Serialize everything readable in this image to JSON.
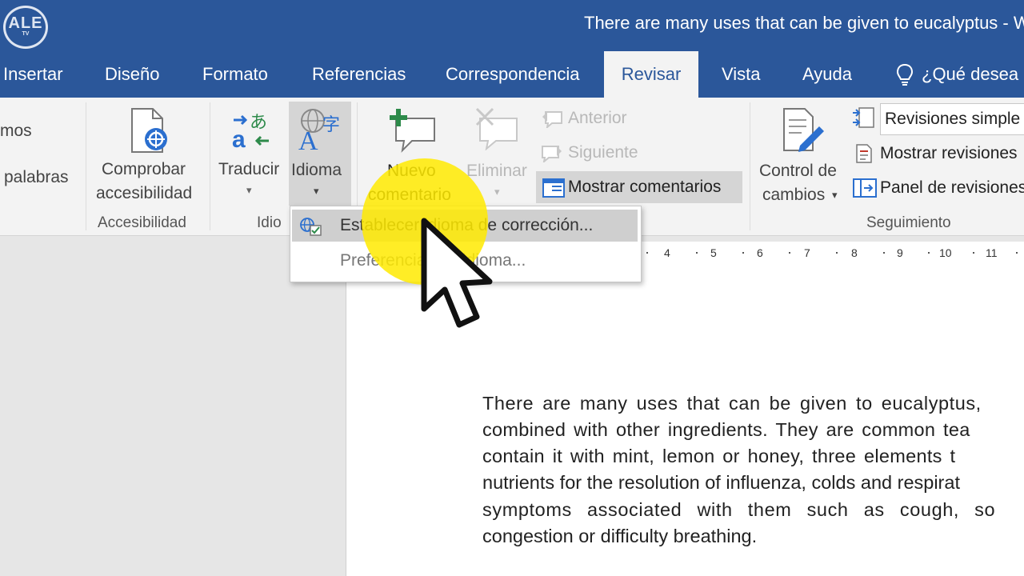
{
  "window": {
    "logo_text": "ALE",
    "logo_sub": "TV",
    "title": "There are many uses that can be given to eucalyptus  -  W"
  },
  "tabs": [
    {
      "label": "Insertar"
    },
    {
      "label": "Diseño"
    },
    {
      "label": "Formato"
    },
    {
      "label": "Referencias"
    },
    {
      "label": "Correspondencia"
    },
    {
      "label": "Revisar",
      "active": true
    },
    {
      "label": "Vista"
    },
    {
      "label": "Ayuda"
    }
  ],
  "tell_me": "¿Qué desea h",
  "ribbon": {
    "left_partial_1": "mos",
    "left_partial_2": "palabras",
    "accessibility": {
      "button_line1": "Comprobar",
      "button_line2": "accesibilidad",
      "group_label": "Accesibilidad"
    },
    "language": {
      "translate": "Traducir",
      "language_btn": "Idioma",
      "group_label": "Idio"
    },
    "comments": {
      "new_line1": "Nuevo",
      "new_line2": "comentario",
      "delete": "Eliminar",
      "previous": "Anterior",
      "next": "Siguiente",
      "show_comments": "Mostrar comentarios"
    },
    "tracking": {
      "control_line1": "Control de",
      "control_line2": "cambios",
      "revisions_select": "Revisiones simple",
      "show_revisions": "Mostrar revisiones",
      "revisions_pane": "Panel de revisiones",
      "group_label": "Seguimiento"
    }
  },
  "dropdown": {
    "items": [
      {
        "label": "Establecer idioma de corrección..."
      },
      {
        "label": "Preferencias de idioma..."
      }
    ]
  },
  "ruler": {
    "ticks": [
      "4",
      "5",
      "6",
      "7",
      "8",
      "9",
      "10",
      "11"
    ]
  },
  "document": {
    "lines": [
      "There are many uses that can be given to eucalyptus,",
      "combined with other ingredients. They are common tea",
      "contain it with mint, lemon or honey, three elements t",
      "nutrients for the resolution of influenza, colds and respirat",
      "symptoms associated with them such as cough, so",
      "congestion or difficulty breathing."
    ]
  },
  "colors": {
    "title_bar": "#2b579a",
    "ribbon_bg": "#f3f3f3",
    "cursor_highlight": "#ffea00"
  }
}
